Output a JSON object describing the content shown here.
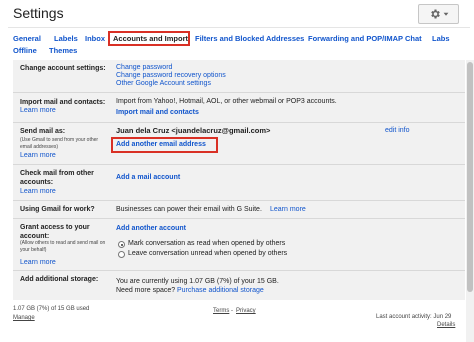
{
  "header": {
    "title": "Settings"
  },
  "tabs": [
    {
      "label": "General"
    },
    {
      "label": "Labels"
    },
    {
      "label": "Inbox"
    },
    {
      "label": "Accounts and Import"
    },
    {
      "label": "Filters and Blocked Addresses"
    },
    {
      "label": "Forwarding and POP/IMAP"
    },
    {
      "label": "Chat"
    },
    {
      "label": "Labs"
    },
    {
      "label": "Offline"
    },
    {
      "label": "Themes"
    }
  ],
  "rows": {
    "change_account": {
      "label": "Change account settings:",
      "links": [
        "Change password",
        "Change password recovery options",
        "Other Google Account settings"
      ]
    },
    "import": {
      "label": "Import mail and contacts:",
      "sub": "Learn more",
      "text": "Import from Yahoo!, Hotmail, AOL, or other webmail or POP3 accounts.",
      "link": "Import mail and contacts"
    },
    "send_as": {
      "label": "Send mail as:",
      "sub": "(Use Gmail to send from your other email addresses)",
      "learn": "Learn more",
      "address": "Juan dela Cruz <juandelacruz@gmail.com>",
      "edit": "edit info",
      "add": "Add another email address"
    },
    "check_mail": {
      "label": "Check mail from other accounts:",
      "learn": "Learn more",
      "link": "Add a mail account"
    },
    "work": {
      "label": "Using Gmail for work?",
      "text": "Businesses can power their email with G Suite.",
      "learn": "Learn more"
    },
    "grant": {
      "label": "Grant access to your account:",
      "sub": "(Allow others to read and send mail on your behalf)",
      "learn": "Learn more",
      "link": "Add another account",
      "option1": "Mark conversation as read when opened by others",
      "option2": "Leave conversation unread when opened by others",
      "selected": 1
    },
    "storage": {
      "label": "Add additional storage:",
      "text": "You are currently using 1.07 GB (7%) of your 15 GB.",
      "need": "Need more space?",
      "link": "Purchase additional storage"
    }
  },
  "footer": {
    "usage": "1.07 GB (7%) of 15 GB used",
    "usage_fraction": 0.07,
    "manage": "Manage",
    "terms": "Terms",
    "sep": "-",
    "privacy": "Privacy",
    "activity": "Last account activity: Jun 29",
    "details": "Details"
  }
}
